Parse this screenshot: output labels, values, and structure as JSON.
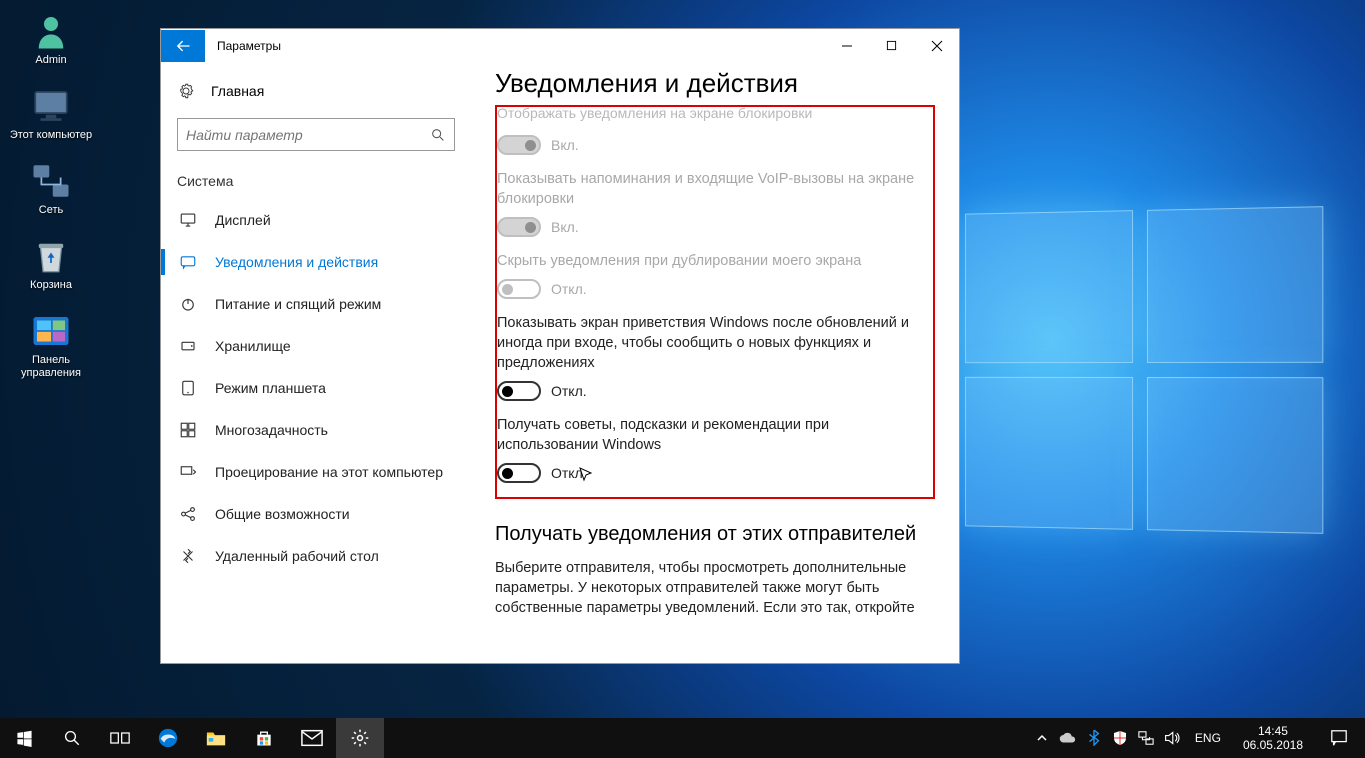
{
  "desktop": {
    "icons": [
      "Admin",
      "Этот компьютер",
      "Сеть",
      "Корзина",
      "Панель управления"
    ]
  },
  "window": {
    "title": "Параметры",
    "home": "Главная",
    "searchPlaceholder": "Найти параметр",
    "section": "Система",
    "nav": [
      "Дисплей",
      "Уведомления и действия",
      "Питание и спящий режим",
      "Хранилище",
      "Режим планшета",
      "Многозадачность",
      "Проецирование на этот компьютер",
      "Общие возможности",
      "Удаленный рабочий стол"
    ],
    "pageTitle": "Уведомления и действия",
    "ghostLine": "Отображать уведомления на экране блокировки",
    "settings": [
      {
        "label": "",
        "state": "Вкл.",
        "disabled": true,
        "on": true
      },
      {
        "label": "Показывать напоминания и входящие VoIP-вызовы на экране блокировки",
        "state": "Вкл.",
        "disabled": true,
        "on": true
      },
      {
        "label": "Скрыть уведомления при дублировании моего экрана",
        "state": "Откл.",
        "disabled": true,
        "on": false
      },
      {
        "label": "Показывать экран приветствия Windows после обновлений и иногда при входе, чтобы сообщить о новых функциях и предложениях",
        "state": "Откл.",
        "disabled": false,
        "on": false
      },
      {
        "label": "Получать советы, подсказки и рекомендации при использовании Windows",
        "state": "Откл.",
        "disabled": false,
        "on": false
      }
    ],
    "subTitle": "Получать уведомления от этих отправителей",
    "subBody": "Выберите отправителя, чтобы просмотреть дополнительные параметры. У некоторых отправителей также могут быть собственные параметры уведомлений. Если это так, откройте"
  },
  "taskbar": {
    "lang": "ENG",
    "time": "14:45",
    "date": "06.05.2018"
  }
}
